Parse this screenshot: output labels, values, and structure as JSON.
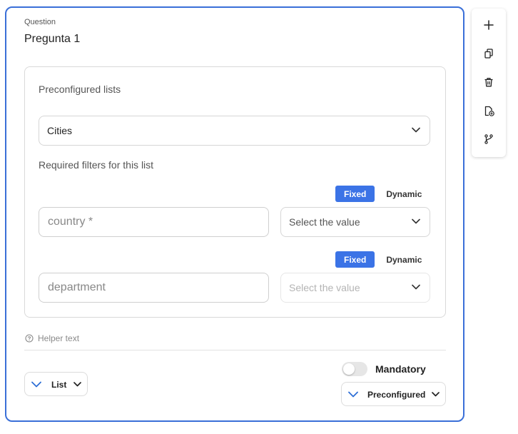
{
  "question": {
    "label": "Question",
    "title": "Pregunta 1"
  },
  "preconfigured": {
    "section_label": "Preconfigured lists",
    "selected_list": "Cities",
    "filters_label": "Required filters for this list"
  },
  "filters": [
    {
      "mode_fixed": "Fixed",
      "mode_dynamic": "Dynamic",
      "field_placeholder": "country *",
      "value_placeholder": "Select the value"
    },
    {
      "mode_fixed": "Fixed",
      "mode_dynamic": "Dynamic",
      "field_placeholder": "department",
      "value_placeholder": "Select the value"
    }
  ],
  "helper_text": "Helper text",
  "footer": {
    "type_label": "List",
    "mandatory_label": "Mandatory",
    "mandatory_on": false,
    "source_label": "Preconfigured"
  },
  "toolbar": {
    "icons": [
      "plus-icon",
      "copy-icon",
      "trash-icon",
      "add-file-icon",
      "branch-icon"
    ]
  },
  "colors": {
    "accent": "#3a6fd8",
    "fixed_button": "#3b73e6",
    "chevron_blue": "#2f6fd6"
  }
}
